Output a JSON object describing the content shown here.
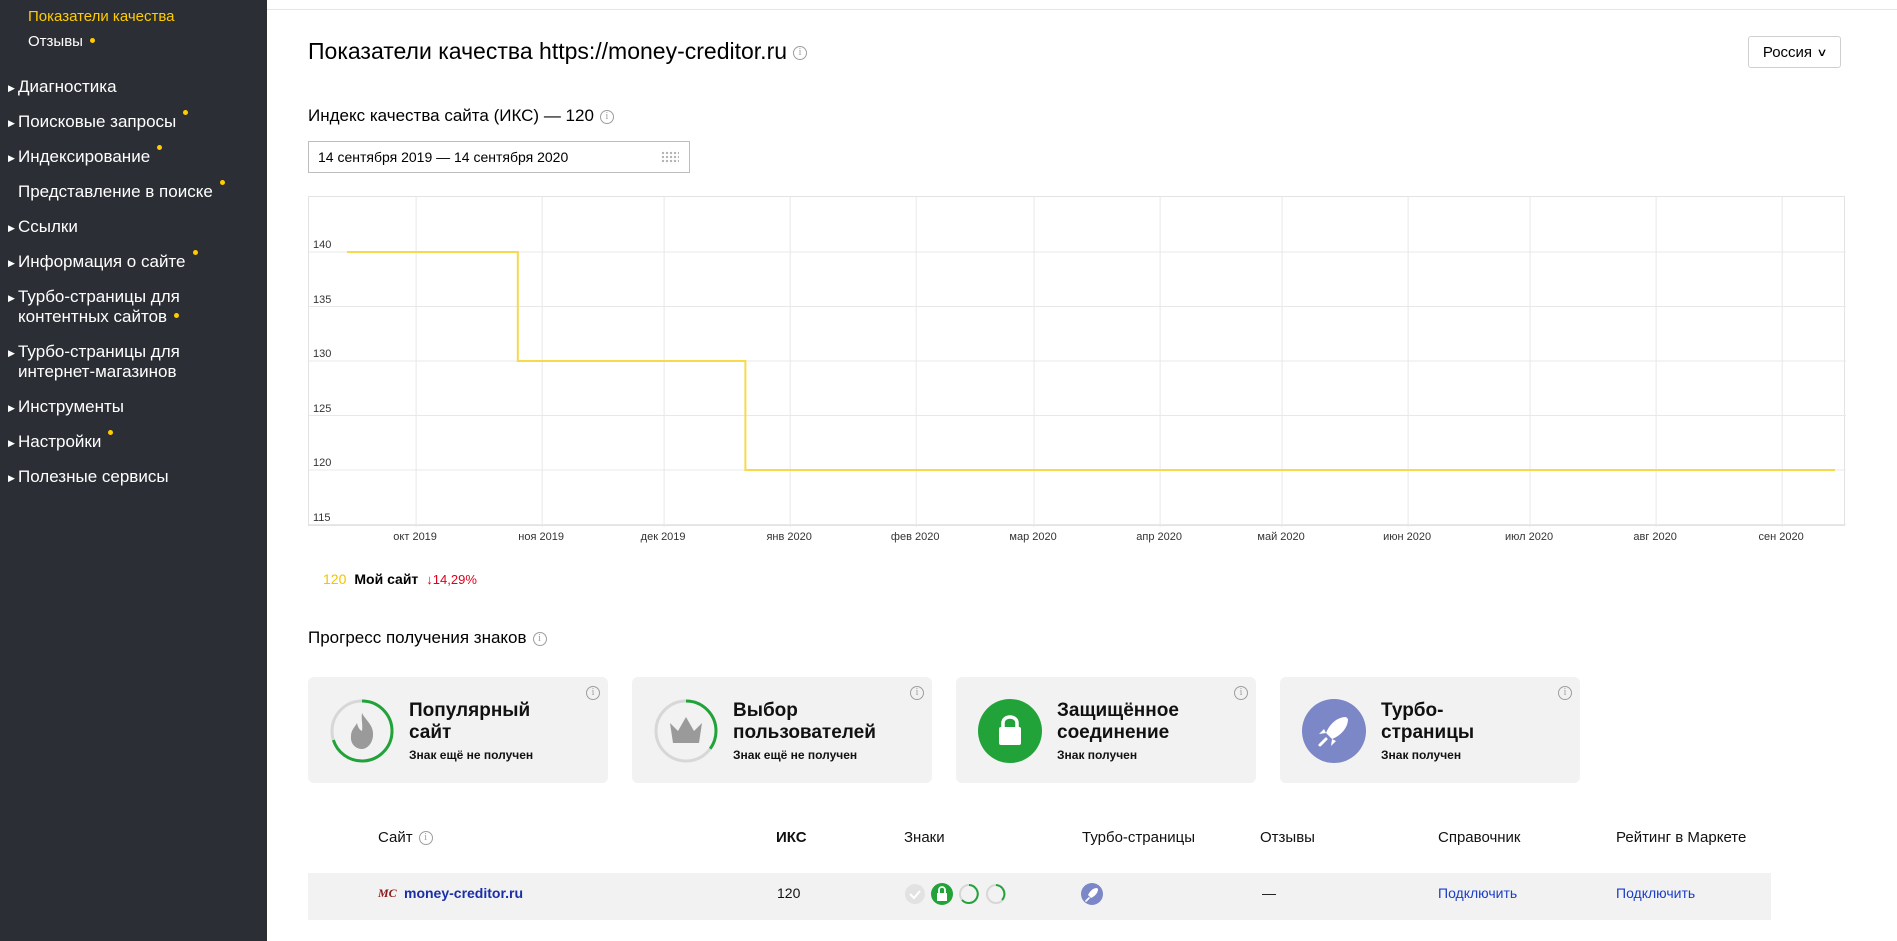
{
  "sidebar": {
    "subitems": [
      {
        "label": "Показатели качества",
        "active": true
      },
      {
        "label": "Отзывы",
        "dot": true
      }
    ],
    "items": [
      {
        "label": "Диагностика",
        "arrow": true,
        "dot": false
      },
      {
        "label": "Поисковые запросы",
        "arrow": true,
        "dot": true
      },
      {
        "label": "Индексирование",
        "arrow": true,
        "dot": true
      },
      {
        "label": "Представление в поиске",
        "arrow": false,
        "dot": true
      },
      {
        "label": "Ссылки",
        "arrow": true,
        "dot": false
      },
      {
        "label": "Информация о сайте",
        "arrow": true,
        "dot": true
      },
      {
        "label": "Турбо-страницы для",
        "label2": "контентных сайтов",
        "arrow": true,
        "dot": true
      },
      {
        "label": "Турбо-страницы для",
        "label2": "интернет-магазинов",
        "arrow": true,
        "dot": false
      },
      {
        "label": "Инструменты",
        "arrow": true,
        "dot": false
      },
      {
        "label": "Настройки",
        "arrow": true,
        "dot": true
      },
      {
        "label": "Полезные сервисы",
        "arrow": true,
        "dot": false
      }
    ]
  },
  "header": {
    "title": "Показатели качества https://money-creditor.ru",
    "region": "Россия"
  },
  "iks": {
    "title": "Индекс качества сайта (ИКС) — 120",
    "date_range": "14 сентября 2019 — 14 сентября 2020"
  },
  "colors": {
    "sidebar_bg": "#2b2e34",
    "accent": "#ffcc00",
    "line": "#f7d94c",
    "green": "#22a33a",
    "turbo": "#7b87c6",
    "link": "#1a3ec7",
    "negative": "#e0001b"
  },
  "chart_data": {
    "type": "line",
    "title": "",
    "xlabel": "",
    "ylabel": "",
    "ylim": [
      115,
      140
    ],
    "yticks": [
      140,
      135,
      130,
      125,
      120,
      115
    ],
    "xticks": [
      "окт 2019",
      "ноя 2019",
      "дек 2019",
      "янв 2020",
      "фев 2020",
      "мар 2020",
      "апр 2020",
      "май 2020",
      "июн 2020",
      "июл 2020",
      "авг 2020",
      "сен 2020"
    ],
    "grid": true,
    "series": [
      {
        "name": "Мой сайт",
        "color": "#f7d94c",
        "points": [
          {
            "x": "2019-09-14",
            "y": 140
          },
          {
            "x": "2019-10-26",
            "y": 140
          },
          {
            "x": "2019-10-26",
            "y": 130
          },
          {
            "x": "2019-12-21",
            "y": 130
          },
          {
            "x": "2019-12-21",
            "y": 120
          },
          {
            "x": "2020-09-14",
            "y": 120
          }
        ]
      }
    ]
  },
  "legend": {
    "value": "120",
    "name": "Мой сайт",
    "change": "↓14,29%"
  },
  "progress": {
    "title": "Прогресс получения знаков",
    "badges": [
      {
        "name1": "Популярный",
        "name2": "сайт",
        "status": "Знак ещё не получен",
        "icon": "flame-icon",
        "progress": 0.7
      },
      {
        "name1": "Выбор",
        "name2": "пользователей",
        "status": "Знак ещё не получен",
        "icon": "crown-icon",
        "progress": 0.35
      },
      {
        "name1": "Защищённое",
        "name2": "соединение",
        "status": "Знак получен",
        "icon": "lock-icon",
        "progress": 1
      },
      {
        "name1": "Турбо-",
        "name2": "страницы",
        "status": "Знак получен",
        "icon": "rocket-icon",
        "progress": 1
      }
    ]
  },
  "table": {
    "headers": {
      "site": "Сайт",
      "iks": "ИКС",
      "badges": "Знаки",
      "turbo": "Турбо-страницы",
      "reviews": "Отзывы",
      "directory": "Справочник",
      "market": "Рейтинг в Маркете"
    },
    "row": {
      "favicon": "MC",
      "site": "money-creditor.ru",
      "iks": "120",
      "reviews": "—",
      "directory": "Подключить",
      "market": "Подключить"
    }
  }
}
